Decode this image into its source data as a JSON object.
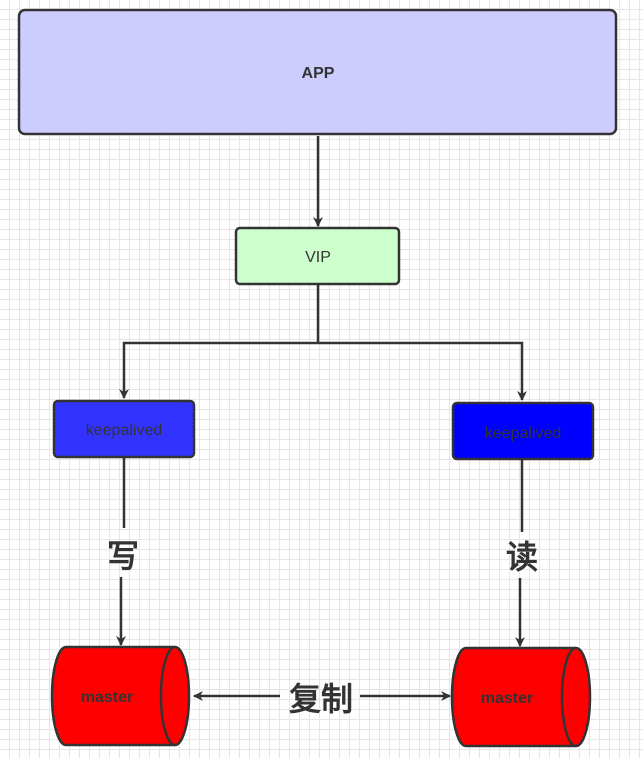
{
  "nodes": {
    "app": {
      "label": "APP",
      "fill": "#ccccff"
    },
    "vip": {
      "label": "VIP",
      "fill": "#ccffcc"
    },
    "keepalived_left": {
      "label": "keepalived",
      "fill": "#3333ff"
    },
    "keepalived_right": {
      "label": "keepalived",
      "fill": "#0000ff"
    },
    "master_left": {
      "label": "master",
      "fill": "#ff0000"
    },
    "master_right": {
      "label": "master",
      "fill": "#ff0000"
    }
  },
  "edges": {
    "write_label": "写",
    "read_label": "读",
    "replicate_label": "复制"
  },
  "colors": {
    "stroke": "#333333",
    "text": "#333333"
  }
}
